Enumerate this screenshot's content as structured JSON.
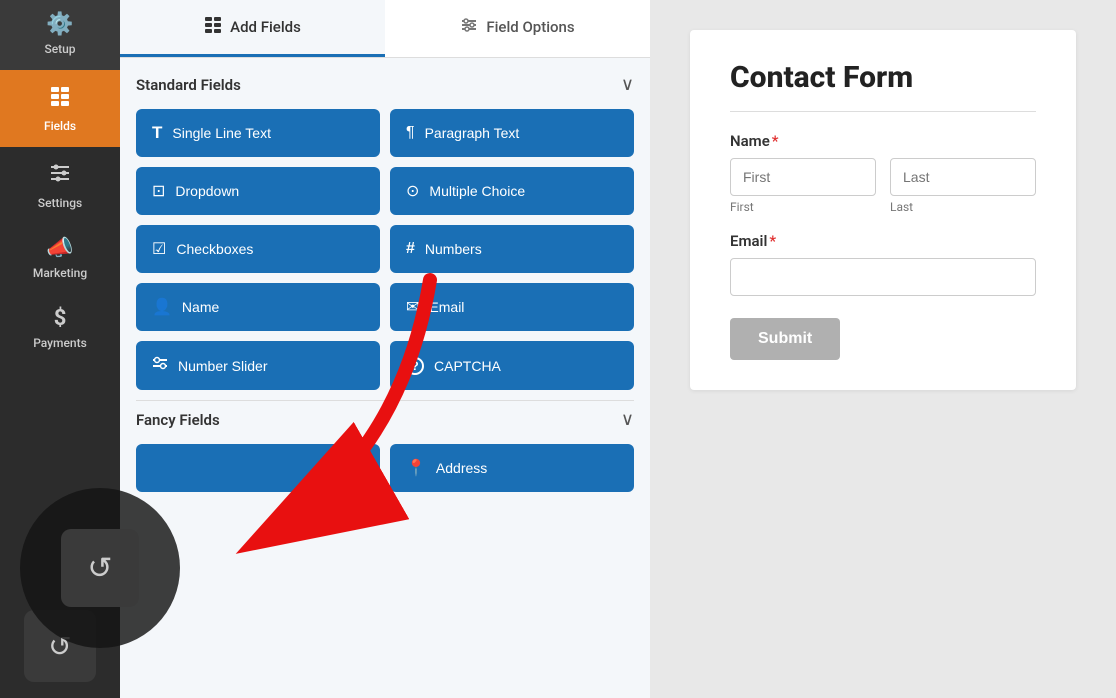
{
  "sidebar": {
    "items": [
      {
        "label": "Setup",
        "icon": "⚙️",
        "active": false
      },
      {
        "label": "Fields",
        "icon": "▦",
        "active": true
      },
      {
        "label": "Settings",
        "icon": "⚙",
        "active": false
      },
      {
        "label": "Marketing",
        "icon": "📣",
        "active": false
      },
      {
        "label": "Payments",
        "icon": "$",
        "active": false
      }
    ],
    "history_icon": "↺"
  },
  "tabs": [
    {
      "label": "Add Fields",
      "icon": "▦",
      "active": true
    },
    {
      "label": "Field Options",
      "icon": "⚙",
      "active": false
    }
  ],
  "standard_fields": {
    "section_title": "Standard Fields",
    "fields": [
      {
        "label": "Single Line Text",
        "icon": "T"
      },
      {
        "label": "Paragraph Text",
        "icon": "¶"
      },
      {
        "label": "Dropdown",
        "icon": "⊡"
      },
      {
        "label": "Multiple Choice",
        "icon": "⊙"
      },
      {
        "label": "Checkboxes",
        "icon": "☑"
      },
      {
        "label": "Numbers",
        "icon": "#"
      },
      {
        "label": "Name",
        "icon": "👤"
      },
      {
        "label": "Email",
        "icon": "✉"
      },
      {
        "label": "Number Slider",
        "icon": "⚡"
      },
      {
        "label": "CAPTCHA",
        "icon": "?"
      }
    ]
  },
  "fancy_fields": {
    "section_title": "Fancy Fields",
    "fields": [
      {
        "label": "",
        "icon": ""
      },
      {
        "label": "Address",
        "icon": "📍"
      }
    ]
  },
  "form_preview": {
    "title": "Contact Form",
    "name_label": "Name",
    "name_required": true,
    "first_placeholder": "First",
    "last_placeholder": "Last",
    "email_label": "Email",
    "email_required": true,
    "submit_label": "Submit"
  }
}
